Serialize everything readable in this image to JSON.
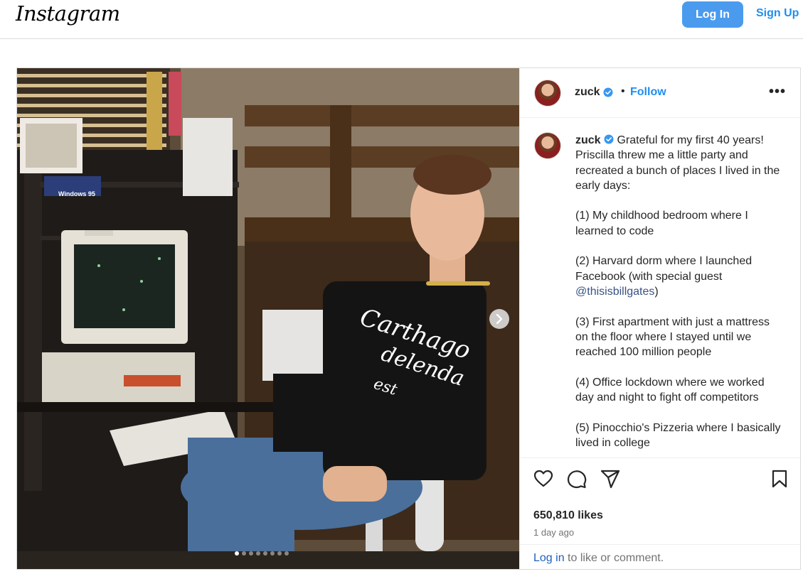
{
  "topbar": {
    "logo": "Instagram",
    "login_label": "Log In",
    "signup_label": "Sign Up"
  },
  "post": {
    "username": "zuck",
    "separator": "•",
    "follow_label": "Follow",
    "more_label": "•••",
    "caption_paragraphs": [
      "Grateful for my first 40 years! Priscilla threw me a little party and recreated a bunch of places I lived in the early days:",
      "(1) My childhood bedroom where I learned to code",
      "(2) Harvard dorm where I launched Facebook (with special guest ",
      "(3) First apartment with just a mattress on the floor where I stayed until we reached 100 million people",
      "(4) Office lockdown where we worked day and night to fight off competitors",
      "(5) Pinocchio's Pizzeria where I basically lived in college"
    ],
    "mention": "@thisisbillgates",
    "mention_suffix": ")",
    "likes": "650,810 likes",
    "time_ago": "1 day ago",
    "login_link": "Log in",
    "login_suffix": " to like or comment.",
    "carousel": {
      "slides": 8,
      "active_index": 0
    },
    "photo_text": {
      "shirt_line1": "Carthago",
      "shirt_line2": "delenda",
      "shirt_line3": "est",
      "box_label": "Windows 95"
    }
  },
  "icons": {
    "verified": "verified-badge-icon",
    "like": "heart-icon",
    "comment": "comment-icon",
    "share": "paper-plane-icon",
    "save": "bookmark-icon",
    "next": "chevron-right-icon"
  },
  "colors": {
    "accent": "#1f8ef1",
    "login_button": "#4a9bee",
    "verified": "#3897f0"
  }
}
